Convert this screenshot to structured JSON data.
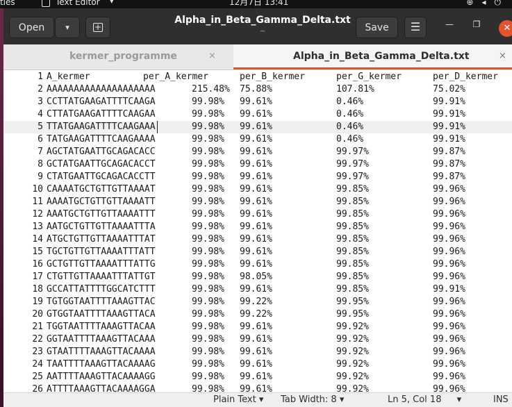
{
  "topbar": {
    "activities": "ties",
    "app_name": "Text Editor",
    "app_caret": "▾",
    "clock": "12月7日  13:41",
    "tray_icons": [
      "network-icon",
      "volume-icon",
      "power-icon"
    ]
  },
  "window": {
    "open_label": "Open",
    "open_dropdown": "▾",
    "new_tab_icon": "+",
    "title": "Alpha_in_Beta_Gamma_Delta.txt",
    "subtitle": "~",
    "save_label": "Save",
    "menu_icon": "☰",
    "minimize": "—",
    "maximize": "❐",
    "close": "✕"
  },
  "tabs": [
    {
      "label": "kermer_programme",
      "close": "×",
      "active": false
    },
    {
      "label": "Alpha_in_Beta_Gamma_Delta.txt",
      "close": "×",
      "active": true
    }
  ],
  "editor": {
    "current_line": 5,
    "lines": [
      {
        "n": "1",
        "seq": "A_kermer",
        "a": "per_A_kermer",
        "b": "per_B_kermer",
        "g": "per_G_kermer",
        "d": "per_D_kermer"
      },
      {
        "n": "2",
        "seq": "AAAAAAAAAAAAAAAAAAAA",
        "a": "215.48%",
        "b": "75.88%",
        "g": "107.81%",
        "d": "75.02%"
      },
      {
        "n": "3",
        "seq": "CCTTATGAAGATTTTCAAGA",
        "a": "99.98%",
        "b": "99.61%",
        "g": "0.46%",
        "d": "99.91%"
      },
      {
        "n": "4",
        "seq": "CTTATGAAGATTTTCAAGAA",
        "a": "99.98%",
        "b": "99.61%",
        "g": "0.46%",
        "d": "99.91%"
      },
      {
        "n": "5",
        "seq": "TTATGAAGATTTTCAAGAAA",
        "a": "99.98%",
        "b": "99.61%",
        "g": "0.46%",
        "d": "99.91%"
      },
      {
        "n": "6",
        "seq": "TATGAAGATTTTCAAGAAAA",
        "a": "99.98%",
        "b": "99.61%",
        "g": "0.46%",
        "d": "99.91%"
      },
      {
        "n": "7",
        "seq": "AGCTATGAATTGCAGACACC",
        "a": "99.98%",
        "b": "99.61%",
        "g": "99.97%",
        "d": "99.87%"
      },
      {
        "n": "8",
        "seq": "GCTATGAATTGCAGACACCT",
        "a": "99.98%",
        "b": "99.61%",
        "g": "99.97%",
        "d": "99.87%"
      },
      {
        "n": "9",
        "seq": "CTATGAATTGCAGACACCTT",
        "a": "99.98%",
        "b": "99.61%",
        "g": "99.97%",
        "d": "99.87%"
      },
      {
        "n": "10",
        "seq": "CAAAATGCTGTTGTTAAAAT",
        "a": "99.98%",
        "b": "99.61%",
        "g": "99.85%",
        "d": "99.96%"
      },
      {
        "n": "11",
        "seq": "AAAATGCTGTTGTTAAAATT",
        "a": "99.98%",
        "b": "99.61%",
        "g": "99.85%",
        "d": "99.96%"
      },
      {
        "n": "12",
        "seq": "AAATGCTGTTGTTAAAATTT",
        "a": "99.98%",
        "b": "99.61%",
        "g": "99.85%",
        "d": "99.96%"
      },
      {
        "n": "13",
        "seq": "AATGCTGTTGTTAAAATTTA",
        "a": "99.98%",
        "b": "99.61%",
        "g": "99.85%",
        "d": "99.96%"
      },
      {
        "n": "14",
        "seq": "ATGCTGTTGTTAAAATTTAT",
        "a": "99.98%",
        "b": "99.61%",
        "g": "99.85%",
        "d": "99.96%"
      },
      {
        "n": "15",
        "seq": "TGCTGTTGTTAAAATTTATT",
        "a": "99.98%",
        "b": "99.61%",
        "g": "99.85%",
        "d": "99.96%"
      },
      {
        "n": "16",
        "seq": "GCTGTTGTTAAAATTTATTG",
        "a": "99.98%",
        "b": "99.61%",
        "g": "99.85%",
        "d": "99.96%"
      },
      {
        "n": "17",
        "seq": "CTGTTGTTAAAATTTATTGT",
        "a": "99.98%",
        "b": "98.05%",
        "g": "99.85%",
        "d": "99.96%"
      },
      {
        "n": "18",
        "seq": "GCCATTATTTTGGCATCTTT",
        "a": "99.98%",
        "b": "99.61%",
        "g": "99.85%",
        "d": "99.91%"
      },
      {
        "n": "19",
        "seq": "TGTGGTAATTTTAAAGTTAC",
        "a": "99.98%",
        "b": "99.22%",
        "g": "99.95%",
        "d": "99.96%"
      },
      {
        "n": "20",
        "seq": "GTGGTAATTTTAAAGTTACA",
        "a": "99.98%",
        "b": "99.22%",
        "g": "99.95%",
        "d": "99.96%"
      },
      {
        "n": "21",
        "seq": "TGGTAATTTTAAAGTTACAA",
        "a": "99.98%",
        "b": "99.61%",
        "g": "99.92%",
        "d": "99.96%"
      },
      {
        "n": "22",
        "seq": "GGTAATTTTAAAGTTACAAA",
        "a": "99.98%",
        "b": "99.61%",
        "g": "99.92%",
        "d": "99.96%"
      },
      {
        "n": "23",
        "seq": "GTAATTTTAAAGTTACAAAA",
        "a": "99.98%",
        "b": "99.61%",
        "g": "99.92%",
        "d": "99.96%"
      },
      {
        "n": "24",
        "seq": "TAATTTTAAAGTTACAAAAG",
        "a": "99.98%",
        "b": "99.61%",
        "g": "99.92%",
        "d": "99.96%"
      },
      {
        "n": "25",
        "seq": "AATTTTAAAGTTACAAAAGG",
        "a": "99.98%",
        "b": "99.61%",
        "g": "99.92%",
        "d": "99.96%"
      },
      {
        "n": "26",
        "seq": "ATTTTAAAGTTACAAAAGGA",
        "a": "99.98%",
        "b": "99.61%",
        "g": "99.92%",
        "d": "99.96%"
      }
    ]
  },
  "statusbar": {
    "language": "Plain Text ▾",
    "tab_width": "Tab Width: 8 ▾",
    "position": "Ln 5, Col 18",
    "position_caret": "▾",
    "mode": "INS"
  },
  "colors": {
    "headerbar": "#2f2f2f",
    "accent": "#e95420",
    "close_button": "#e2542b"
  }
}
